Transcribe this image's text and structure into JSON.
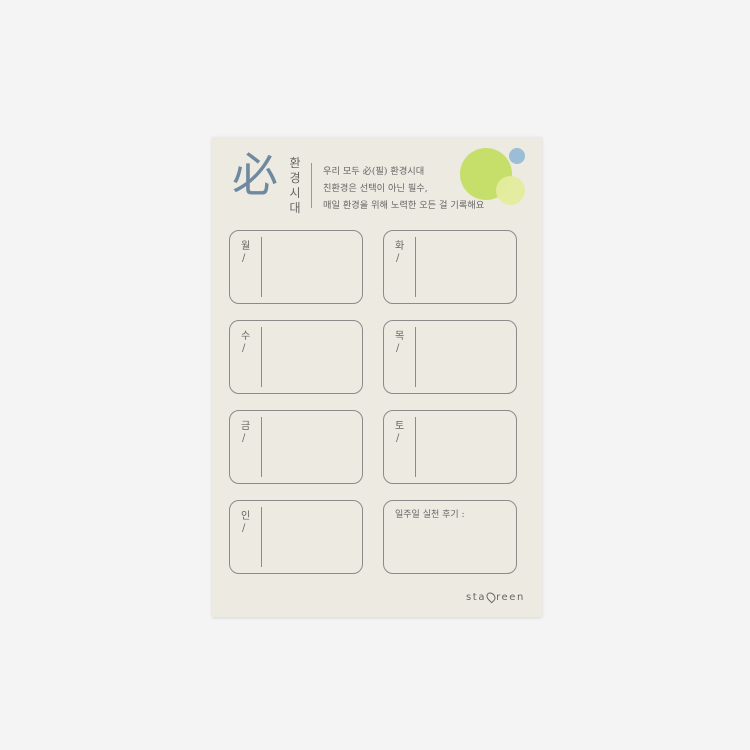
{
  "header": {
    "mark": "必",
    "vertical_title": [
      "환",
      "경",
      "시",
      "대"
    ],
    "intro_lines": [
      "우리 모두 必(필) 환경시대",
      "친환경은 선택이 아닌 필수,",
      "매일 환경을 위해 노력한 오든 걸 기록해요"
    ]
  },
  "days": [
    {
      "label": "월",
      "slash": "/"
    },
    {
      "label": "화",
      "slash": "/"
    },
    {
      "label": "수",
      "slash": "/"
    },
    {
      "label": "목",
      "slash": "/"
    },
    {
      "label": "금",
      "slash": "/"
    },
    {
      "label": "토",
      "slash": "/"
    },
    {
      "label": "인",
      "slash": "/"
    }
  ],
  "review": {
    "label": "일주일 실천 후기 :"
  },
  "brand": {
    "prefix": "sta",
    "suffix": "reen",
    "icon": "leaf-icon"
  },
  "colors": {
    "card": "#eceae1",
    "mark": "#6f8aa0",
    "circle_green": "#c6de6a",
    "circle_yellow": "#e4ec9d",
    "circle_blue": "#9bbed6"
  }
}
